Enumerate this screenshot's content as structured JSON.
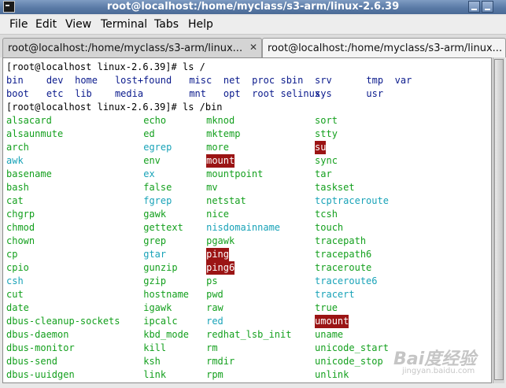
{
  "window": {
    "title": "root@localhost:/home/myclass/s3-arm/linux-2.6.39"
  },
  "menu": [
    "File",
    "Edit",
    "View",
    "Terminal",
    "Tabs",
    "Help"
  ],
  "tabs": [
    {
      "label": "root@localhost:/home/myclass/s3-arm/linux...",
      "close": "✕"
    },
    {
      "label": "root@localhost:/home/myclass/s3-arm/linux..."
    }
  ],
  "terminal": {
    "prompt1": "[root@localhost linux-2.6.39]# ls /",
    "ls_root": [
      [
        {
          "t": "bin",
          "c": "dir"
        },
        {
          "t": "dev",
          "c": "dir"
        },
        {
          "t": "home",
          "c": "dir"
        },
        {
          "t": "lost+found",
          "c": "dir"
        },
        {
          "t": "misc",
          "c": "dir"
        },
        {
          "t": "net",
          "c": "dir"
        },
        {
          "t": "proc",
          "c": "dir"
        },
        {
          "t": "sbin",
          "c": "dir"
        },
        {
          "t": "srv",
          "c": "dir"
        },
        {
          "t": "tmp",
          "c": "dir"
        },
        {
          "t": "var",
          "c": "dir"
        }
      ],
      [
        {
          "t": "boot",
          "c": "dir"
        },
        {
          "t": "etc",
          "c": "dir"
        },
        {
          "t": "lib",
          "c": "dir"
        },
        {
          "t": "media",
          "c": "dir"
        },
        {
          "t": "mnt",
          "c": "dir"
        },
        {
          "t": "opt",
          "c": "dir"
        },
        {
          "t": "root",
          "c": "dir"
        },
        {
          "t": "selinux",
          "c": "dir"
        },
        {
          "t": "sys",
          "c": "dir"
        },
        {
          "t": "usr",
          "c": "dir"
        }
      ]
    ],
    "prompt2": "[root@localhost linux-2.6.39]# ls /bin",
    "ls_bin": [
      [
        {
          "t": "alsacard",
          "c": "exe"
        },
        {
          "t": "echo",
          "c": "exe"
        },
        {
          "t": "mknod",
          "c": "exe"
        },
        {
          "t": "sort",
          "c": "exe"
        }
      ],
      [
        {
          "t": "alsaunmute",
          "c": "exe"
        },
        {
          "t": "ed",
          "c": "exe"
        },
        {
          "t": "mktemp",
          "c": "exe"
        },
        {
          "t": "stty",
          "c": "exe"
        }
      ],
      [
        {
          "t": "arch",
          "c": "exe"
        },
        {
          "t": "egrep",
          "c": "lnk"
        },
        {
          "t": "more",
          "c": "exe"
        },
        {
          "t": "su",
          "c": "suid"
        }
      ],
      [
        {
          "t": "awk",
          "c": "lnk"
        },
        {
          "t": "env",
          "c": "exe"
        },
        {
          "t": "mount",
          "c": "suid"
        },
        {
          "t": "sync",
          "c": "exe"
        }
      ],
      [
        {
          "t": "basename",
          "c": "exe"
        },
        {
          "t": "ex",
          "c": "lnk"
        },
        {
          "t": "mountpoint",
          "c": "exe"
        },
        {
          "t": "tar",
          "c": "exe"
        }
      ],
      [
        {
          "t": "bash",
          "c": "exe"
        },
        {
          "t": "false",
          "c": "exe"
        },
        {
          "t": "mv",
          "c": "exe"
        },
        {
          "t": "taskset",
          "c": "exe"
        }
      ],
      [
        {
          "t": "cat",
          "c": "exe"
        },
        {
          "t": "fgrep",
          "c": "lnk"
        },
        {
          "t": "netstat",
          "c": "exe"
        },
        {
          "t": "tcptraceroute",
          "c": "lnk"
        }
      ],
      [
        {
          "t": "chgrp",
          "c": "exe"
        },
        {
          "t": "gawk",
          "c": "exe"
        },
        {
          "t": "nice",
          "c": "exe"
        },
        {
          "t": "tcsh",
          "c": "exe"
        }
      ],
      [
        {
          "t": "chmod",
          "c": "exe"
        },
        {
          "t": "gettext",
          "c": "exe"
        },
        {
          "t": "nisdomainname",
          "c": "lnk"
        },
        {
          "t": "touch",
          "c": "exe"
        }
      ],
      [
        {
          "t": "chown",
          "c": "exe"
        },
        {
          "t": "grep",
          "c": "exe"
        },
        {
          "t": "pgawk",
          "c": "exe"
        },
        {
          "t": "tracepath",
          "c": "exe"
        }
      ],
      [
        {
          "t": "cp",
          "c": "exe"
        },
        {
          "t": "gtar",
          "c": "lnk"
        },
        {
          "t": "ping",
          "c": "suid"
        },
        {
          "t": "tracepath6",
          "c": "exe"
        }
      ],
      [
        {
          "t": "cpio",
          "c": "exe"
        },
        {
          "t": "gunzip",
          "c": "exe"
        },
        {
          "t": "ping6",
          "c": "suid"
        },
        {
          "t": "traceroute",
          "c": "exe"
        }
      ],
      [
        {
          "t": "csh",
          "c": "lnk"
        },
        {
          "t": "gzip",
          "c": "exe"
        },
        {
          "t": "ps",
          "c": "exe"
        },
        {
          "t": "traceroute6",
          "c": "lnk"
        }
      ],
      [
        {
          "t": "cut",
          "c": "exe"
        },
        {
          "t": "hostname",
          "c": "exe"
        },
        {
          "t": "pwd",
          "c": "exe"
        },
        {
          "t": "tracert",
          "c": "lnk"
        }
      ],
      [
        {
          "t": "date",
          "c": "exe"
        },
        {
          "t": "igawk",
          "c": "exe"
        },
        {
          "t": "raw",
          "c": "exe"
        },
        {
          "t": "true",
          "c": "exe"
        }
      ],
      [
        {
          "t": "dbus-cleanup-sockets",
          "c": "exe"
        },
        {
          "t": "ipcalc",
          "c": "exe"
        },
        {
          "t": "red",
          "c": "lnk"
        },
        {
          "t": "umount",
          "c": "suid"
        }
      ],
      [
        {
          "t": "dbus-daemon",
          "c": "exe"
        },
        {
          "t": "kbd_mode",
          "c": "exe"
        },
        {
          "t": "redhat_lsb_init",
          "c": "exe"
        },
        {
          "t": "uname",
          "c": "exe"
        }
      ],
      [
        {
          "t": "dbus-monitor",
          "c": "exe"
        },
        {
          "t": "kill",
          "c": "exe"
        },
        {
          "t": "rm",
          "c": "exe"
        },
        {
          "t": "unicode_start",
          "c": "exe"
        }
      ],
      [
        {
          "t": "dbus-send",
          "c": "exe"
        },
        {
          "t": "ksh",
          "c": "exe"
        },
        {
          "t": "rmdir",
          "c": "exe"
        },
        {
          "t": "unicode_stop",
          "c": "exe"
        }
      ],
      [
        {
          "t": "dbus-uuidgen",
          "c": "exe"
        },
        {
          "t": "link",
          "c": "exe"
        },
        {
          "t": "rpm",
          "c": "exe"
        },
        {
          "t": "unlink",
          "c": "exe"
        }
      ]
    ]
  },
  "colors": {
    "dir": "#0a1a8c",
    "exe": "#14a01e",
    "link": "#19a3b8",
    "suid_bg": "#9b1414"
  },
  "watermark": {
    "brand": "Bai度经验",
    "site": "jingyan.baidu.com"
  }
}
